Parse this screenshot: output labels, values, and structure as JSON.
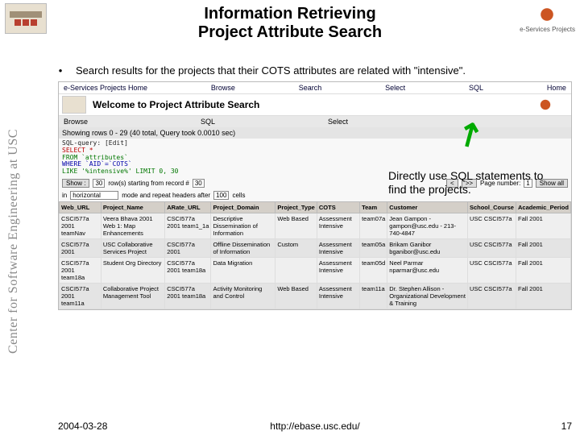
{
  "header": {
    "title_line1": "Information Retrieving",
    "title_line2": "Project Attribute Search",
    "logo_right_sub": "e-Services Projects"
  },
  "sidebar_text": "Center for Software Engineering at USC",
  "bullet": "Search results for the projects that their COTS attributes are related with \"intensive\".",
  "callout": "Directly use SQL statements to find the projects.",
  "topnav": [
    "e-Services Projects Home",
    "Browse",
    "Search",
    "Select",
    "SQL",
    "Home"
  ],
  "welcome": "Welcome to Project Attribute Search",
  "subnav": [
    "Browse",
    "SQL",
    "Select"
  ],
  "rows_info": "Showing rows 0 - 29 (40 total, Query took 0.0010 sec)",
  "sql": {
    "l1": "SQL-query: [Edit]",
    "l2": "SELECT *",
    "l3": "FROM `attributes`",
    "l4": "WHERE `AID`=`COTS`",
    "l5": "LIKE '%intensive%' LIMIT 0, 30"
  },
  "controls": {
    "show_btn": "Show :",
    "show_val": "30",
    "show_txt": "row(s) starting from record #",
    "start_val": "30",
    "nav1": "<",
    "nav2": ">>",
    "page_lbl": "Page number:",
    "page_sel": "1",
    "end_btn": "Show all"
  },
  "controls2": {
    "in_lbl": "in",
    "mode": "horizontal",
    "txt1": "mode and repeat headers after",
    "cells": "100",
    "txt2": "cells"
  },
  "columns": [
    "Web_URL",
    "Project_Name",
    "ARate_URL",
    "Project_Domain",
    "Project_Type",
    "COTS",
    "Team",
    "Customer",
    "School_Course",
    "Academic_Period"
  ],
  "rows": [
    [
      "CSCI577a 2001 teamNav",
      "Veera Bhava 2001 Web 1: Map Enhancements",
      "CSCI577a 2001 team1_1a",
      "Descriptive Dissemination of Information",
      "Web Based",
      "Assessment Intensive",
      "team07a",
      "Jean Gampon - gampon@usc.edu - 213-740-4847",
      "USC CSCI577a",
      "Fall  2001"
    ],
    [
      "CSCI577a 2001",
      "USC Collaborative Services Project",
      "CSCI577a 2001",
      "Offline Dissemination of Information",
      "Custom",
      "Assessment Intensive",
      "team05a",
      "Brikam Ganibor bganibor@usc.edu",
      "USC CSCI577a",
      "Fall  2001"
    ],
    [
      "CSCI577a 2001 team18a",
      "Student Org Directory",
      "CSCI577a 2001 team18a",
      "Data Migration",
      "",
      "Assessment Intensive",
      "team05d",
      "Neel Parmar nparmar@usc.edu",
      "USC CSCI577a",
      "Fall  2001"
    ],
    [
      "CSCI577a 2001 team11a",
      "Collaborative Project Management Tool",
      "CSCI577a 2001 team18a",
      "Activity Monitoring and Control",
      "Web Based",
      "Assessment Intensive",
      "team11a",
      "Dr. Stephen Allison - Organizational Development & Training",
      "USC CSCI577a",
      "Fall  2001"
    ]
  ],
  "footer": {
    "date": "2004-03-28",
    "url": "http://ebase.usc.edu/",
    "page": "17"
  }
}
